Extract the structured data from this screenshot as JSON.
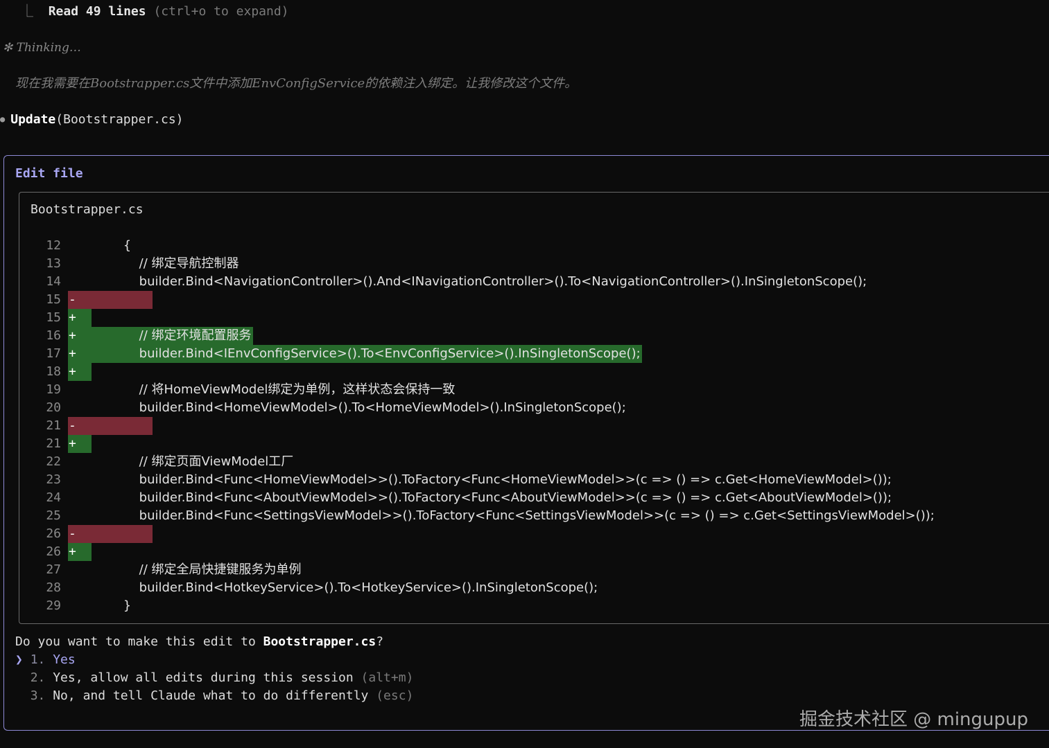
{
  "read_line": {
    "corner": "⎿",
    "read": "Read",
    "count": "49",
    "lines": "lines",
    "hint": "(ctrl+o to expand)"
  },
  "thinking": {
    "label": "✻ Thinking…",
    "body": "现在我需要在Bootstrapper.cs文件中添加EnvConfigService的依赖注入绑定。让我修改这个文件。"
  },
  "update": {
    "dot": "●",
    "tool": "Update",
    "arg": "(Bootstrapper.cs)"
  },
  "edit_box": {
    "title": "Edit file",
    "file_name": "Bootstrapper.cs"
  },
  "diff_lines": [
    {
      "no": "12",
      "sign": "",
      "type": "ctx",
      "code": "        {"
    },
    {
      "no": "13",
      "sign": "",
      "type": "ctx",
      "code": "            // 绑定导航控制器"
    },
    {
      "no": "14",
      "sign": "",
      "type": "ctx",
      "code": "            builder.Bind<NavigationController>().And<INavigationController>().To<NavigationController>().InSingletonScope();"
    },
    {
      "no": "15",
      "sign": "-",
      "type": "del",
      "code": ""
    },
    {
      "no": "15",
      "sign": "+",
      "type": "add",
      "code": ""
    },
    {
      "no": "16",
      "sign": "+",
      "type": "add",
      "code": "            // 绑定环境配置服务"
    },
    {
      "no": "17",
      "sign": "+",
      "type": "add",
      "code": "            builder.Bind<IEnvConfigService>().To<EnvConfigService>().InSingletonScope();"
    },
    {
      "no": "18",
      "sign": "+",
      "type": "add",
      "code": ""
    },
    {
      "no": "19",
      "sign": "",
      "type": "ctx",
      "code": "            // 将HomeViewModel绑定为单例，这样状态会保持一致"
    },
    {
      "no": "20",
      "sign": "",
      "type": "ctx",
      "code": "            builder.Bind<HomeViewModel>().To<HomeViewModel>().InSingletonScope();"
    },
    {
      "no": "21",
      "sign": "-",
      "type": "del",
      "code": ""
    },
    {
      "no": "21",
      "sign": "+",
      "type": "add",
      "code": ""
    },
    {
      "no": "22",
      "sign": "",
      "type": "ctx",
      "code": "            // 绑定页面ViewModel工厂"
    },
    {
      "no": "23",
      "sign": "",
      "type": "ctx",
      "code": "            builder.Bind<Func<HomeViewModel>>().ToFactory<Func<HomeViewModel>>(c => () => c.Get<HomeViewModel>());"
    },
    {
      "no": "24",
      "sign": "",
      "type": "ctx",
      "code": "            builder.Bind<Func<AboutViewModel>>().ToFactory<Func<AboutViewModel>>(c => () => c.Get<AboutViewModel>());"
    },
    {
      "no": "25",
      "sign": "",
      "type": "ctx",
      "code": "            builder.Bind<Func<SettingsViewModel>>().ToFactory<Func<SettingsViewModel>>(c => () => c.Get<SettingsViewModel>());"
    },
    {
      "no": "26",
      "sign": "-",
      "type": "del",
      "code": ""
    },
    {
      "no": "26",
      "sign": "+",
      "type": "add",
      "code": ""
    },
    {
      "no": "27",
      "sign": "",
      "type": "ctx",
      "code": "            // 绑定全局快捷键服务为单例"
    },
    {
      "no": "28",
      "sign": "",
      "type": "ctx",
      "code": "            builder.Bind<HotkeyService>().To<HotkeyService>().InSingletonScope();"
    },
    {
      "no": "29",
      "sign": "",
      "type": "ctx",
      "code": "        }"
    }
  ],
  "prompt": {
    "pre": "Do you want to make this edit to ",
    "file": "Bootstrapper.cs",
    "post": "?"
  },
  "options": [
    {
      "cursor": "❯",
      "num": "1.",
      "label": "Yes",
      "hint": ""
    },
    {
      "cursor": "",
      "num": "2.",
      "label": "Yes, allow all edits during this session",
      "hint": "(alt+m)"
    },
    {
      "cursor": "",
      "num": "3.",
      "label": "No, and tell Claude what to do differently",
      "hint": "(esc)"
    }
  ],
  "watermark": "掘金技术社区 @ mingupup",
  "colors": {
    "background": "#0c0c0c",
    "accent": "#a8a6f2",
    "deletion": "#7a2a36",
    "addition": "#276a2c",
    "border_outer": "#8e8ad6",
    "border_inner": "#6a6a6a"
  }
}
